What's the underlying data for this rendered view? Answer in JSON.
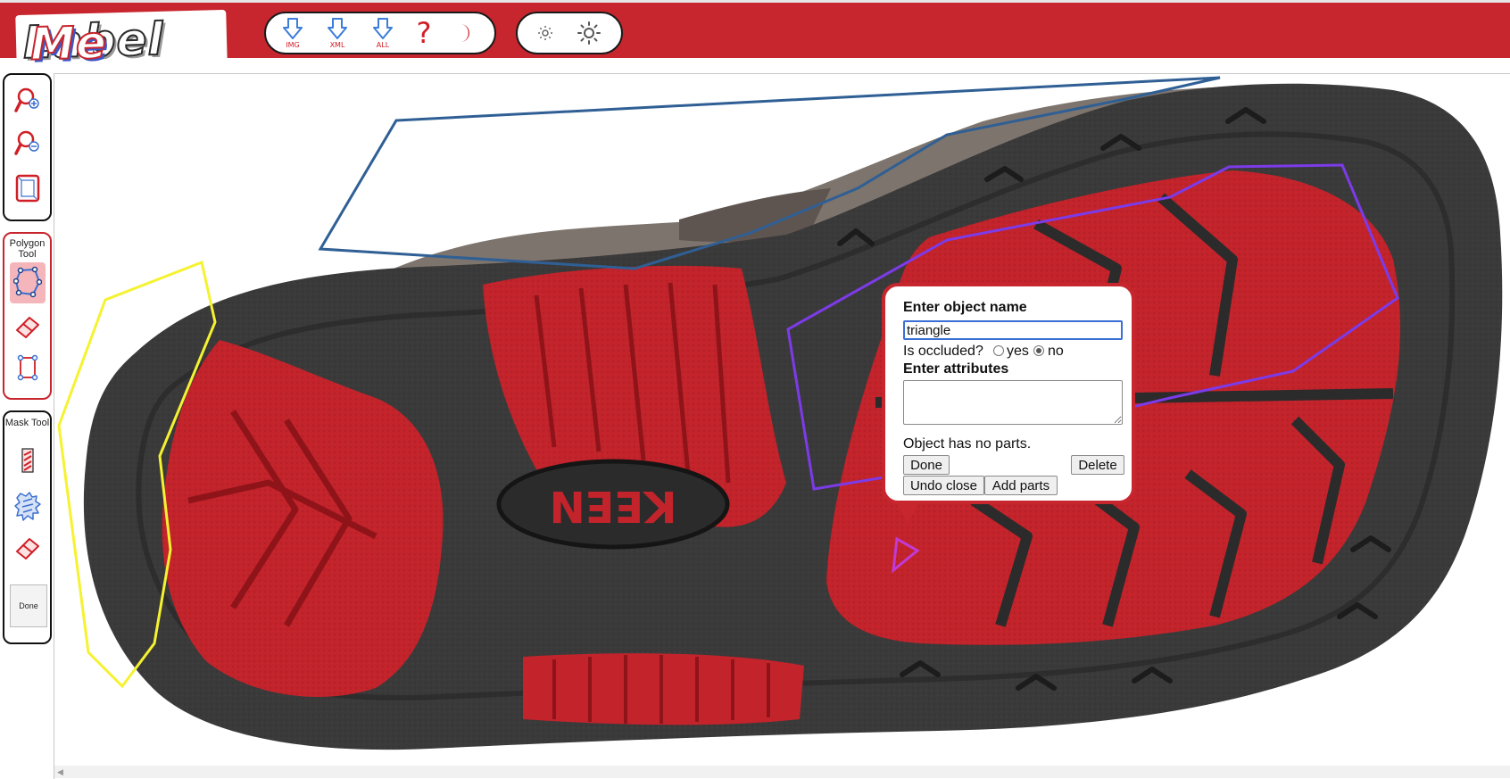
{
  "app": {
    "logo_text": "LabelMe"
  },
  "header": {
    "downloads": [
      {
        "name": "download-image",
        "label": "IMG"
      },
      {
        "name": "download-xml",
        "label": "XML"
      },
      {
        "name": "download-all",
        "label": "ALL"
      }
    ],
    "icons": [
      "help-icon",
      "night-mode-icon",
      "brightness-low-icon",
      "brightness-high-icon"
    ]
  },
  "left_toolbar": {
    "zoom_tools": [
      "zoom-in-icon",
      "zoom-out-icon",
      "fit-to-screen-icon"
    ],
    "polygon_tool_title": "Polygon Tool",
    "polygon_tools": [
      "polygon-icon",
      "eraser-icon",
      "bounding-box-icon"
    ],
    "mask_tool_title": "Mask Tool",
    "mask_tools": [
      "foreground-brush-icon",
      "background-brush-icon",
      "mask-eraser-icon"
    ],
    "mask_done_label": "Done"
  },
  "colors": {
    "brand_red": "#c8262e",
    "polygon_blue": "#2f5f94",
    "polygon_yellow": "#f5f231",
    "polygon_purple": "#7c3be8",
    "polygon_magenta": "#c23ad6"
  },
  "popup": {
    "title": "Enter object name",
    "name_value": "triangle",
    "occluded_label": "Is occluded?",
    "yes_label": "yes",
    "no_label": "no",
    "occluded_selected": "no",
    "attributes_title": "Enter attributes",
    "attributes_value": "",
    "parts_text": "Object has no parts.",
    "done_label": "Done",
    "delete_label": "Delete",
    "undo_close_label": "Undo close",
    "add_parts_label": "Add parts"
  }
}
